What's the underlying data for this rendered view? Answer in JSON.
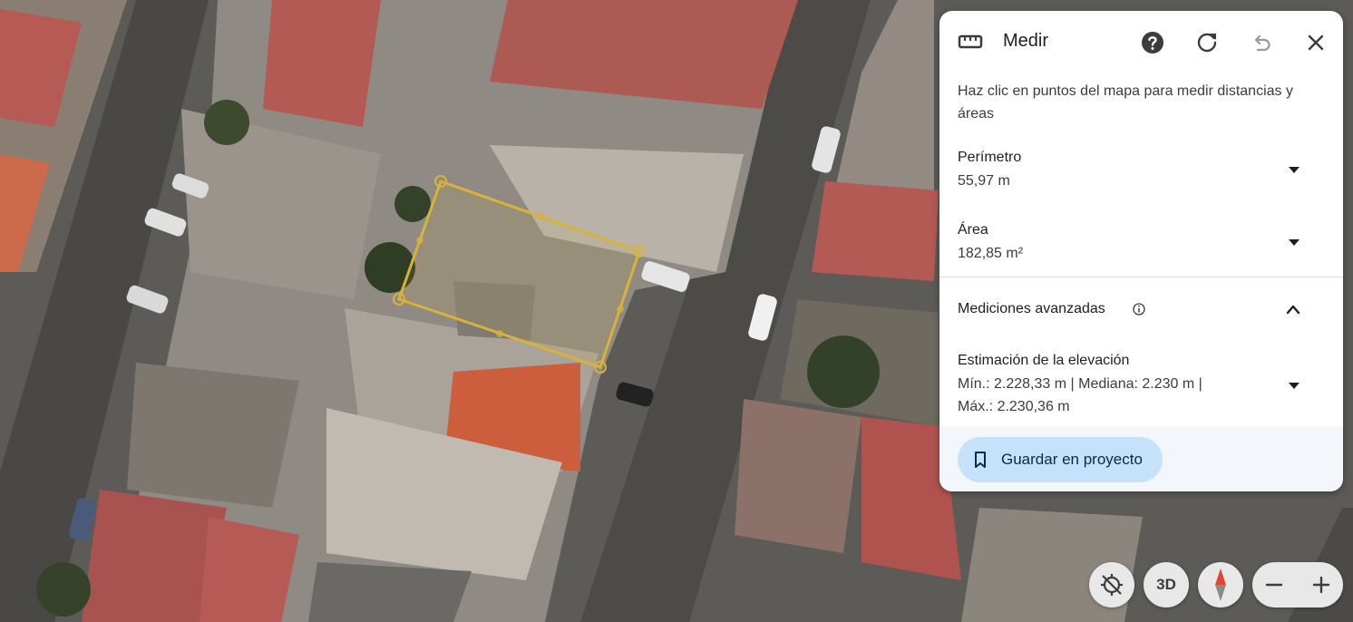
{
  "panel": {
    "title": "Medir",
    "description": "Haz clic en puntos del mapa para medir distancias y áreas",
    "perimeter": {
      "label": "Perímetro",
      "value": "55,97 m"
    },
    "area": {
      "label": "Área",
      "value": "182,85 m²"
    },
    "advanced": {
      "label": "Mediciones avanzadas"
    },
    "elevation": {
      "label": "Estimación de la elevación",
      "line1": "Mín.: 2.228,33 m | Mediana: 2.230 m |",
      "line2": "Máx.: 2.230,36 m"
    },
    "save_label": "Guardar en proyecto"
  },
  "controls": {
    "view_3d": "3D"
  },
  "colors": {
    "accent_button": "#c4e2f9",
    "measure_outline": "#d9b23a"
  },
  "icons": [
    "ruler-icon",
    "help-icon",
    "reset-icon",
    "undo-icon",
    "close-icon",
    "info-icon",
    "bookmark-icon",
    "compass-icon",
    "minus-icon",
    "plus-icon",
    "tilt-icon"
  ]
}
